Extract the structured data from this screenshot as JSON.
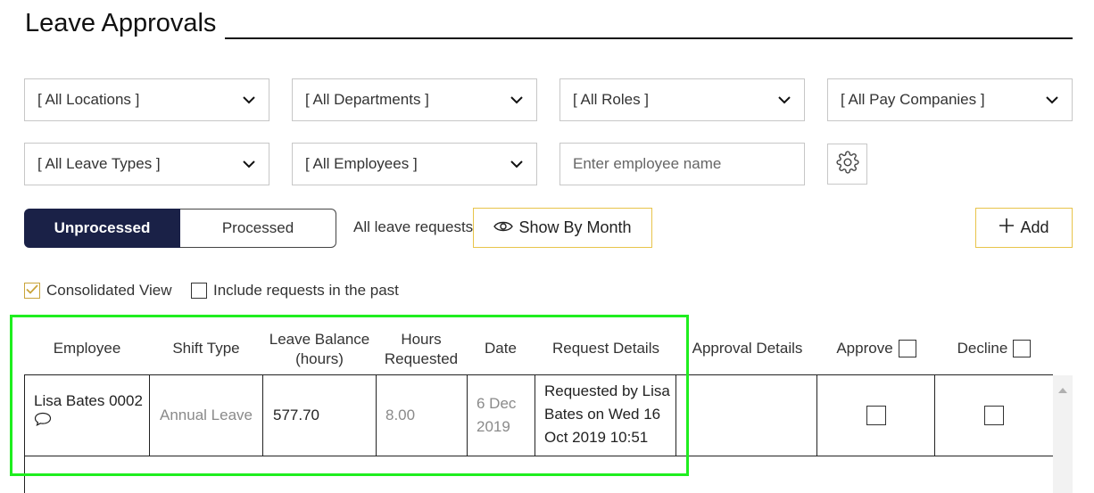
{
  "page": {
    "title": "Leave Approvals"
  },
  "filters": {
    "locations": "[ All Locations ]",
    "departments": "[ All Departments ]",
    "roles": "[ All Roles ]",
    "pay_companies": "[ All Pay Companies ]",
    "leave_types": "[ All Leave Types ]",
    "employees": "[ All Employees ]",
    "employee_name_placeholder": "Enter employee name"
  },
  "toolbar": {
    "tab_unprocessed": "Unprocessed",
    "tab_processed": "Processed",
    "all_leave_requests": "All leave requests",
    "show_by_month": "Show By Month",
    "add_label": "Add"
  },
  "options": {
    "consolidated_view": "Consolidated View",
    "consolidated_checked": true,
    "include_past": "Include requests in the past",
    "include_past_checked": false
  },
  "table": {
    "headers": {
      "employee": "Employee",
      "shift_type": "Shift Type",
      "leave_balance_1": "Leave Balance",
      "leave_balance_2": "(hours)",
      "hours_1": "Hours",
      "hours_2": "Requested",
      "date": "Date",
      "request_details": "Request Details",
      "approval_details": "Approval Details",
      "approve": "Approve",
      "decline": "Decline"
    },
    "rows": [
      {
        "employee": "Lisa Bates 0002",
        "shift_type": "Annual Leave",
        "leave_balance": "577.70",
        "hours_requested": "8.00",
        "date_1": "6 Dec",
        "date_2": "2019",
        "request_1": "Requested by Lisa",
        "request_2": "Bates on Wed 16",
        "request_3": "Oct 2019 10:51",
        "approval_details": ""
      }
    ]
  },
  "colors": {
    "accent_navy": "#1a2147",
    "gold_border": "#e8c44a",
    "highlight_green": "#1fee1f"
  },
  "icons": [
    "chevron-down-icon",
    "gear-icon",
    "eye-icon",
    "plus-icon",
    "check-icon",
    "comment-icon",
    "scroll-up-icon"
  ]
}
